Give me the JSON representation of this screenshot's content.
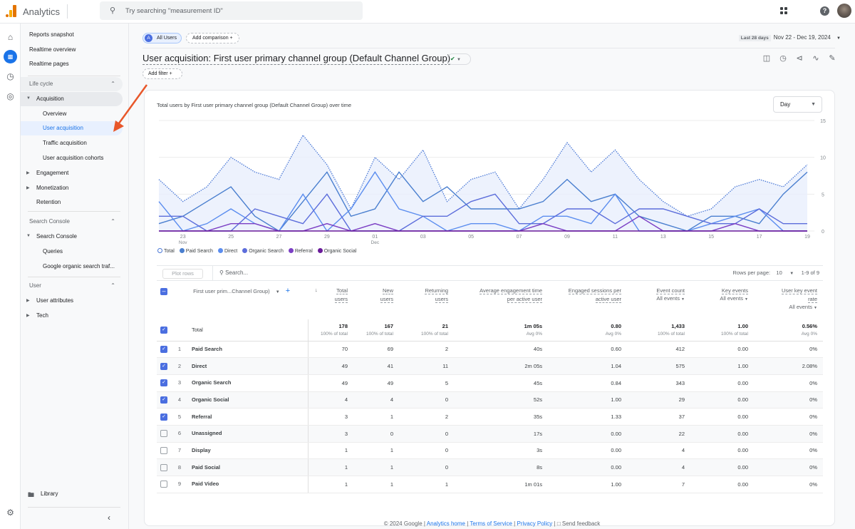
{
  "app": {
    "name": "Analytics",
    "search_placeholder": "Try searching \"measurement ID\""
  },
  "topbar_icons": [
    "apps-grid-icon",
    "help-icon",
    "account-avatar"
  ],
  "rail": [
    "home-icon",
    "reports-icon",
    "explore-icon",
    "advertising-icon",
    "settings-icon"
  ],
  "nav": {
    "top": [
      "Reports snapshot",
      "Realtime overview",
      "Realtime pages"
    ],
    "life_cycle": "Life cycle",
    "acquisition": "Acquisition",
    "acq_items": [
      "Overview",
      "User acquisition",
      "Traffic acquisition",
      "User acquisition cohorts"
    ],
    "engagement": "Engagement",
    "monetization": "Monetization",
    "retention": "Retention",
    "search_console_section": "Search Console",
    "search_console": "Search Console",
    "sc_items": [
      "Queries",
      "Google organic search traf..."
    ],
    "user_section": "User",
    "user_attributes": "User attributes",
    "tech": "Tech",
    "library": "Library"
  },
  "header": {
    "segment_letter": "A",
    "segment": "All Users",
    "add_comparison": "Add comparison",
    "date_label": "Last 28 days",
    "date_range": "Nov 22 - Dec 19, 2024",
    "title": "User acquisition: First user primary channel group (Default Channel Group)",
    "add_filter": "Add filter"
  },
  "card": {
    "chart_title": "Total users by First user primary channel group (Default Channel Group) over time",
    "granularity": "Day"
  },
  "chart_data": {
    "type": "line",
    "title": "Total users by First user primary channel group (Default Channel Group) over time",
    "x": [
      "Nov 22",
      "Nov 23",
      "Nov 24",
      "Nov 25",
      "Nov 26",
      "Nov 27",
      "Nov 28",
      "Nov 29",
      "Nov 30",
      "Dec 01",
      "Dec 02",
      "Dec 03",
      "Dec 04",
      "Dec 05",
      "Dec 06",
      "Dec 07",
      "Dec 08",
      "Dec 09",
      "Dec 10",
      "Dec 11",
      "Dec 12",
      "Dec 13",
      "Dec 14",
      "Dec 15",
      "Dec 16",
      "Dec 17",
      "Dec 18",
      "Dec 19"
    ],
    "x_ticks": [
      {
        "i": 1,
        "label": "23",
        "sub": "Nov"
      },
      {
        "i": 3,
        "label": "25"
      },
      {
        "i": 5,
        "label": "27"
      },
      {
        "i": 7,
        "label": "29"
      },
      {
        "i": 9,
        "label": "01",
        "sub": "Dec"
      },
      {
        "i": 11,
        "label": "03"
      },
      {
        "i": 13,
        "label": "05"
      },
      {
        "i": 15,
        "label": "07"
      },
      {
        "i": 17,
        "label": "09"
      },
      {
        "i": 19,
        "label": "11"
      },
      {
        "i": 21,
        "label": "13"
      },
      {
        "i": 23,
        "label": "15"
      },
      {
        "i": 25,
        "label": "17"
      },
      {
        "i": 27,
        "label": "19"
      }
    ],
    "y_ticks": [
      0,
      5,
      10,
      15
    ],
    "ylim": [
      0,
      15
    ],
    "grid": true,
    "legend_position": "bottom-left",
    "series": [
      {
        "name": "Total",
        "color": "#4a78d6",
        "style": "dotted-area",
        "values": [
          7,
          4,
          6,
          10,
          8,
          7,
          13,
          9,
          3,
          10,
          7,
          11,
          4,
          7,
          8,
          3,
          7,
          12,
          8,
          11,
          7,
          4,
          2,
          3,
          6,
          7,
          6,
          9
        ]
      },
      {
        "name": "Paid Search",
        "color": "#4a7fcf",
        "values": [
          1,
          2,
          4,
          6,
          2,
          0,
          4,
          8,
          2,
          3,
          8,
          4,
          6,
          3,
          3,
          3,
          4,
          7,
          4,
          5,
          2,
          1,
          0,
          2,
          2,
          1,
          5,
          8
        ]
      },
      {
        "name": "Direct",
        "color": "#5b8def",
        "values": [
          4,
          0,
          1,
          3,
          1,
          0,
          5,
          0,
          3,
          8,
          3,
          2,
          0,
          1,
          1,
          0,
          2,
          2,
          1,
          5,
          0,
          0,
          0,
          1,
          2,
          3,
          0,
          0
        ]
      },
      {
        "name": "Organic Search",
        "color": "#5c6ddb",
        "values": [
          2,
          2,
          0,
          0,
          3,
          2,
          1,
          5,
          0,
          0,
          0,
          2,
          2,
          4,
          5,
          1,
          1,
          3,
          3,
          1,
          3,
          3,
          2,
          1,
          1,
          3,
          1,
          1
        ]
      },
      {
        "name": "Referral",
        "color": "#7b3fc4",
        "values": [
          0,
          0,
          0,
          1,
          1,
          0,
          0,
          1,
          0,
          1,
          0,
          0,
          0,
          0,
          0,
          0,
          1,
          0,
          0,
          0,
          2,
          0,
          0,
          0,
          1,
          0,
          0,
          0
        ]
      },
      {
        "name": "Organic Social",
        "color": "#6a1b9a",
        "values": [
          0,
          0,
          0,
          0,
          0,
          0,
          0,
          0,
          0,
          0,
          0,
          0,
          0,
          0,
          0,
          0,
          0,
          0,
          0,
          0,
          0,
          0,
          0,
          0,
          0,
          0,
          0,
          0
        ]
      }
    ]
  },
  "table": {
    "plot_rows": "Plot rows",
    "search_placeholder": "Search...",
    "rows_per_page_label": "Rows per page:",
    "rows_per_page": "10",
    "pagination": "1-9 of 9",
    "dimension_header": "First user prim...Channel Group)",
    "columns": [
      {
        "l1": "Total",
        "l2": "users"
      },
      {
        "l1": "New",
        "l2": "users"
      },
      {
        "l1": "Returning",
        "l2": "users"
      },
      {
        "l1": "Average engagement time",
        "l2": "per active user"
      },
      {
        "l1": "Engaged sessions per",
        "l2": "active user"
      },
      {
        "l1": "Event count",
        "sub": "All events"
      },
      {
        "l1": "Key events",
        "sub": "All events"
      },
      {
        "l1": "User key event",
        "l2": "rate",
        "sub": "All events"
      }
    ],
    "total": {
      "label": "Total",
      "values": [
        "178",
        "167",
        "21",
        "1m 05s",
        "0.80",
        "1,433",
        "1.00",
        "0.56%"
      ],
      "subs": [
        "100% of total",
        "100% of total",
        "100% of total",
        "Avg 0%",
        "Avg 0%",
        "100% of total",
        "100% of total",
        "Avg 0%"
      ]
    },
    "rows": [
      {
        "n": "1",
        "name": "Paid Search",
        "checked": true,
        "values": [
          "70",
          "69",
          "2",
          "40s",
          "0.60",
          "412",
          "0.00",
          "0%"
        ]
      },
      {
        "n": "2",
        "name": "Direct",
        "checked": true,
        "values": [
          "49",
          "41",
          "11",
          "2m 05s",
          "1.04",
          "575",
          "1.00",
          "2.08%"
        ]
      },
      {
        "n": "3",
        "name": "Organic Search",
        "checked": true,
        "values": [
          "49",
          "49",
          "5",
          "45s",
          "0.84",
          "343",
          "0.00",
          "0%"
        ]
      },
      {
        "n": "4",
        "name": "Organic Social",
        "checked": true,
        "values": [
          "4",
          "4",
          "0",
          "52s",
          "1.00",
          "29",
          "0.00",
          "0%"
        ]
      },
      {
        "n": "5",
        "name": "Referral",
        "checked": true,
        "values": [
          "3",
          "1",
          "2",
          "35s",
          "1.33",
          "37",
          "0.00",
          "0%"
        ]
      },
      {
        "n": "6",
        "name": "Unassigned",
        "checked": false,
        "values": [
          "3",
          "0",
          "0",
          "17s",
          "0.00",
          "22",
          "0.00",
          "0%"
        ]
      },
      {
        "n": "7",
        "name": "Display",
        "checked": false,
        "values": [
          "1",
          "1",
          "0",
          "3s",
          "0.00",
          "4",
          "0.00",
          "0%"
        ]
      },
      {
        "n": "8",
        "name": "Paid Social",
        "checked": false,
        "values": [
          "1",
          "1",
          "0",
          "8s",
          "0.00",
          "4",
          "0.00",
          "0%"
        ]
      },
      {
        "n": "9",
        "name": "Paid Video",
        "checked": false,
        "values": [
          "1",
          "1",
          "1",
          "1m 01s",
          "1.00",
          "7",
          "0.00",
          "0%"
        ]
      }
    ]
  },
  "footer": {
    "copyright": "© 2024 Google |",
    "links": [
      "Analytics home",
      "Terms of Service",
      "Privacy Policy"
    ],
    "feedback": "Send feedback"
  }
}
